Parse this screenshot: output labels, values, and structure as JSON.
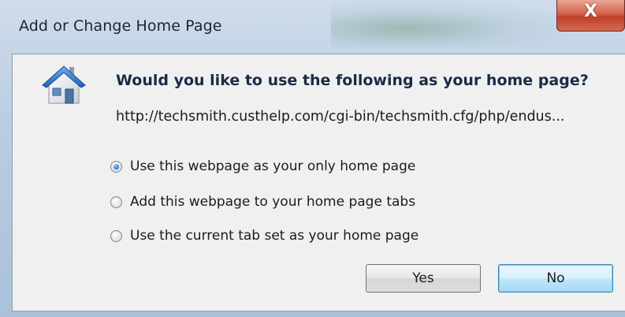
{
  "window": {
    "title": "Add or Change Home Page",
    "close_label": "X"
  },
  "dialog": {
    "icon": "house-icon",
    "question": "Would you like to use the following as your home page?",
    "url": "http://techsmith.custhelp.com/cgi-bin/techsmith.cfg/php/endus...",
    "options": [
      {
        "label": "Use this webpage as your only home page",
        "selected": true
      },
      {
        "label": "Add this webpage to your home page tabs",
        "selected": false
      },
      {
        "label": "Use the current tab set as your home page",
        "selected": false
      }
    ],
    "buttons": {
      "yes": "Yes",
      "no": "No"
    }
  },
  "colors": {
    "title_bar": "#b9cde2",
    "close_button": "#c1402c",
    "question_text": "#1a2b47",
    "dialog_background": "#f0f0f0",
    "focused_button_border": "#3c7fb1"
  }
}
